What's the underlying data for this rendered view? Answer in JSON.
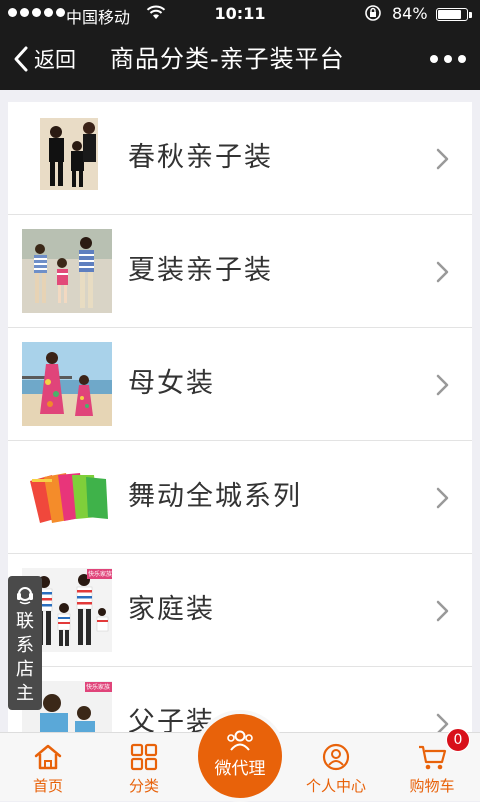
{
  "status": {
    "carrier": "中国移动",
    "time": "10:11",
    "battery_pct": "84%",
    "battery_level": 0.84
  },
  "nav": {
    "back_label": "返回",
    "title": "商品分类-亲子装平台"
  },
  "categories": [
    {
      "label": "春秋亲子装",
      "thumb": "black-outfits-family-photo"
    },
    {
      "label": "夏装亲子装",
      "thumb": "striped-tops-family-photo"
    },
    {
      "label": "母女装",
      "thumb": "floral-dress-beach-photo"
    },
    {
      "label": "舞动全城系列",
      "thumb": "colorful-shorts-photo"
    },
    {
      "label": "家庭装",
      "thumb": "striped-family-photo"
    },
    {
      "label": "父子装",
      "thumb": "father-son-photo"
    }
  ],
  "thumb_badge": "快乐家族",
  "float_contact": {
    "label": "联系店主"
  },
  "tabbar": {
    "home": "首页",
    "category": "分类",
    "agent": "微代理",
    "profile": "个人中心",
    "cart": "购物车",
    "cart_count": "0"
  },
  "colors": {
    "accent": "#e8620a",
    "nav_bg": "#1b1b1b",
    "badge": "#d8101a"
  }
}
